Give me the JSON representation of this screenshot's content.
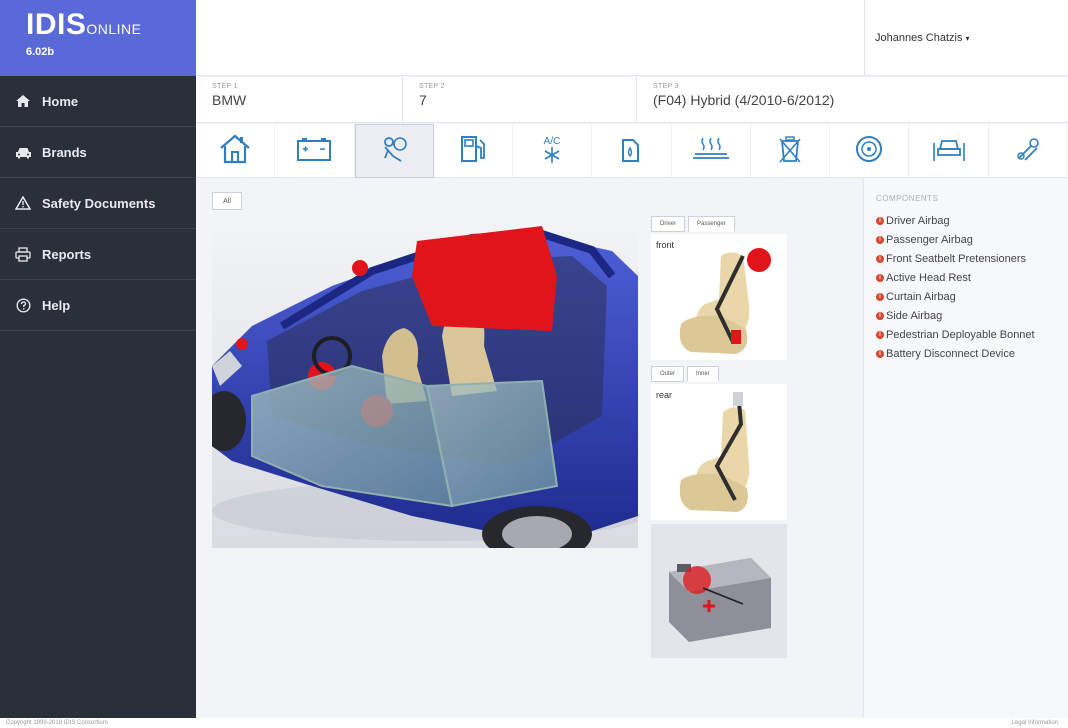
{
  "brand": {
    "logo": "IDIS",
    "logo_suffix": "ONLINE",
    "version": "6.02b"
  },
  "sidebar": {
    "items": [
      {
        "label": "Home",
        "icon": "home-icon"
      },
      {
        "label": "Brands",
        "icon": "car-icon"
      },
      {
        "label": "Safety Documents",
        "icon": "warning-icon"
      },
      {
        "label": "Reports",
        "icon": "printer-icon"
      },
      {
        "label": "Help",
        "icon": "help-icon"
      }
    ]
  },
  "header": {
    "user_name": "Johannes Chatzis",
    "user_caret": "▾"
  },
  "steps": [
    {
      "label": "STEP 1",
      "value": "BMW"
    },
    {
      "label": "STEP 2",
      "value": "7"
    },
    {
      "label": "STEP 3",
      "value": "(F04) Hybrid (4/2010-6/2012)"
    }
  ],
  "icon_tabs": [
    {
      "name": "house-icon",
      "active": false
    },
    {
      "name": "battery-icon",
      "active": false
    },
    {
      "name": "airbag-person-icon",
      "active": true
    },
    {
      "name": "fuel-pump-icon",
      "active": false
    },
    {
      "name": "ac-icon",
      "active": false,
      "text": "A/C"
    },
    {
      "name": "oil-can-icon",
      "active": false
    },
    {
      "name": "heating-icon",
      "active": false
    },
    {
      "name": "recycle-bin-icon",
      "active": false
    },
    {
      "name": "wheel-icon",
      "active": false
    },
    {
      "name": "car-lift-icon",
      "active": false
    },
    {
      "name": "wrench-icon",
      "active": false
    }
  ],
  "main": {
    "all_tab": "All",
    "front_tabs": [
      "Driver",
      "Passenger"
    ],
    "front_label": "front",
    "rear_tabs": [
      "Outer",
      "Inner"
    ],
    "rear_label": "rear"
  },
  "components": {
    "title": "COMPONENTS",
    "items": [
      "Driver Airbag",
      "Passenger Airbag",
      "Front Seatbelt Pretensioners",
      "Active Head Rest",
      "Curtain Airbag",
      "Side Airbag",
      "Pedestrian Deployable Bonnet",
      "Battery Disconnect Device"
    ],
    "marker_color": "#d8462f"
  },
  "footer": {
    "copyright": "Copyright 1999-2018 IDIS Consortium",
    "legal": "Legal Information"
  },
  "colors": {
    "brand": "#5a69d8",
    "sidebar": "#2b2f3a",
    "car_body": "#2f3fb0",
    "airbag": "#e0141a"
  }
}
